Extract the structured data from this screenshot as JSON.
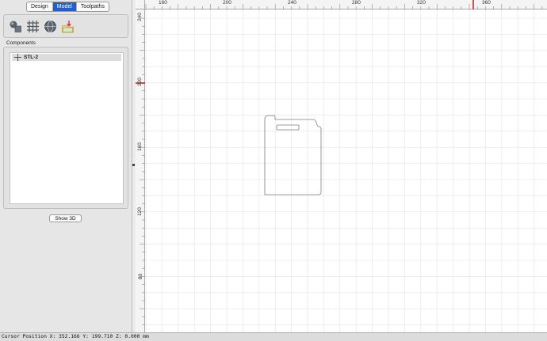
{
  "tabs": [
    {
      "label": "Design",
      "active": false
    },
    {
      "label": "Model",
      "active": true
    },
    {
      "label": "Toolpaths",
      "active": false
    }
  ],
  "toolbar": {
    "icons": [
      "transform-object-icon",
      "mesh-grid-icon",
      "sphere-icon",
      "import-model-icon"
    ]
  },
  "components": {
    "label": "Components",
    "items": [
      {
        "label": "STL-2"
      }
    ]
  },
  "show3d": {
    "label": "Show 3D"
  },
  "ruler": {
    "top_labels": [
      "160",
      "200",
      "240",
      "280",
      "320",
      "360"
    ],
    "left_labels": [
      "240",
      "200",
      "160",
      "120",
      "80"
    ]
  },
  "status": {
    "cursor_position": "Cursor Position X: 352.166 Y: 199.710 Z: 0.000 mm"
  },
  "colors": {
    "accent": "#1f5fd1",
    "cursor_marker": "#d62020",
    "grid_line": "#e3e3e3"
  }
}
